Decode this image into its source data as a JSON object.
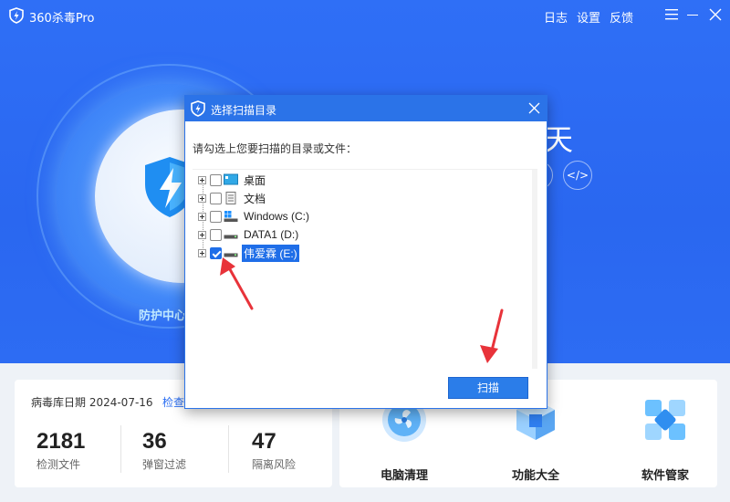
{
  "app": {
    "title": "360杀毒Pro",
    "links": [
      "日志",
      "设置",
      "反馈"
    ],
    "protect_label": "防护中心",
    "headline_char": "天",
    "hero_buttons": [
      "</>"
    ]
  },
  "stats_card": {
    "virus_db_date": "病毒库日期 2024-07-16",
    "check_link": "检查",
    "items": [
      {
        "value": "2181",
        "label": "检测文件"
      },
      {
        "value": "36",
        "label": "弹窗过滤"
      },
      {
        "value": "47",
        "label": "隔离风险"
      }
    ]
  },
  "tools": [
    {
      "label": "电脑清理",
      "icon": "fan-clean-icon"
    },
    {
      "label": "功能大全",
      "icon": "cube-box-icon"
    },
    {
      "label": "软件管家",
      "icon": "software-manager-icon"
    }
  ],
  "dialog": {
    "title": "选择扫描目录",
    "prompt": "请勾选上您要扫描的目录或文件：",
    "scan_button": "扫描",
    "tree": [
      {
        "label": "桌面",
        "checked": false,
        "icon": "desktop-icon"
      },
      {
        "label": "文档",
        "checked": false,
        "icon": "document-icon"
      },
      {
        "label": "Windows (C:)",
        "checked": false,
        "icon": "windows-drive-icon"
      },
      {
        "label": "DATA1 (D:)",
        "checked": false,
        "icon": "drive-icon"
      },
      {
        "label": "伟爱霖 (E:)",
        "checked": true,
        "selected": true,
        "icon": "drive-icon"
      }
    ]
  },
  "colors": {
    "brand_blue": "#2b73e8",
    "hero_blue": "#2f6ff6",
    "annotation_red": "#e8333a"
  }
}
